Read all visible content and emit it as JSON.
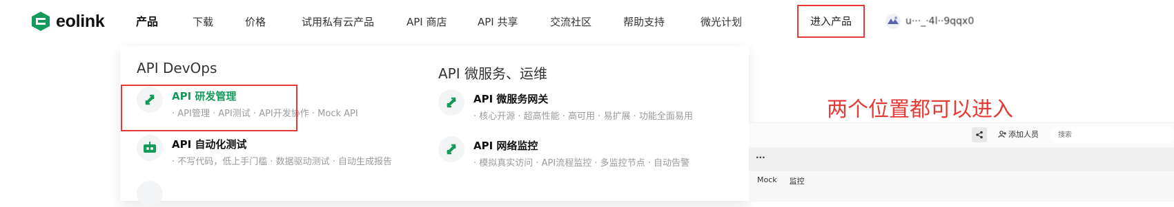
{
  "brand": {
    "name": "eolink",
    "color": "#149a5a"
  },
  "nav": {
    "items": [
      {
        "label": "产品",
        "active": true
      },
      {
        "label": "下载"
      },
      {
        "label": "价格"
      },
      {
        "label": "试用私有云产品"
      },
      {
        "label": "API 商店"
      },
      {
        "label": "API 共享"
      },
      {
        "label": "交流社区"
      },
      {
        "label": "帮助支持"
      },
      {
        "label": "微光计划"
      }
    ],
    "enter_product": "进入产品",
    "user_name": "u···_·4l··9qqx0"
  },
  "panel": {
    "col1_title": "API DevOps",
    "col2_title": "API 微服务、运维",
    "products": [
      {
        "name": "API 研发管理",
        "desc": "· API管理 · API测试 · API开发协作 · Mock API",
        "icon": "transfer-arrows-icon",
        "highlight": true
      },
      {
        "name": "API 自动化测试",
        "desc": "· 不写代码，低上手门槛 · 数据驱动测试 · 自动生成报告",
        "icon": "robot-icon"
      },
      {
        "name": "API 微服务网关",
        "desc": "· 核心开源 · 超高性能 · 高可用 · 易扩展 · 功能全面易用",
        "icon": "transfer-arrows-icon"
      },
      {
        "name": "API 网络监控",
        "desc": "· 模拟真实访问 · API流程监控 · 多监控节点 · 自动告警",
        "icon": "transfer-arrows-icon"
      }
    ]
  },
  "annotation": "两个位置都可以进入",
  "bg_app": {
    "add_member": "添加人员",
    "search_placeholder": "搜索",
    "dots": "...",
    "tabs": [
      "Mock",
      "监控"
    ]
  },
  "colors": {
    "highlight_red": "#e53935",
    "accent_green": "#149a5a"
  }
}
